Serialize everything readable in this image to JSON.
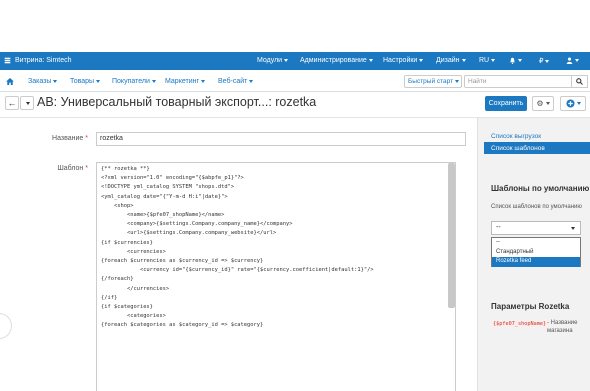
{
  "topbar": {
    "store": "Витрина: Simtech",
    "modules": "Модули",
    "admin": "Администрирование",
    "settings": "Настройки",
    "design": "Дизайн",
    "lang": "RU",
    "currency": "₽"
  },
  "menu": {
    "orders": "Заказы",
    "products": "Товары",
    "customers": "Покупатели",
    "marketing": "Маркетинг",
    "website": "Веб-сайт",
    "quick_start": "Быстрый старт",
    "search_placeholder": "Найти"
  },
  "page": {
    "title": "AB: Универсальный товарный экспорт...: rozetka",
    "save": "Сохранить"
  },
  "form": {
    "name_label": "Название",
    "name_value": "rozetka",
    "template_label": "Шаблон",
    "template_lines": [
      "{** rozetka **}",
      "<?xml version=\"1.0\" encoding=\"{$abpfe_p1}\"?>",
      "<!DOCTYPE yml_catalog SYSTEM \"shops.dtd\">",
      "<yml_catalog date=\"{\"Y-m-d H:i\"|date}\">",
      "    <shop>",
      "        <name>{$pfe07_shopName}</name>",
      "        <company>{$settings.Company.company_name}</company>",
      "        <url>{$settings.Company.company_website}</url>",
      "{if $currencies}",
      "        <currencies>",
      "{foreach $currencies as $currency_id => $currency}",
      "            <currency id=\"{$currency_id}\" rate=\"{$currency.coefficient|default:1}\"/>",
      "{/foreach}",
      "        </currencies>",
      "{/if}",
      "{if $categories}",
      "        <categories>",
      "{foreach $categories as $category_id => $category}"
    ]
  },
  "sidebar": {
    "links": [
      "Список выгрузок",
      "Список шаблонов"
    ],
    "default_title": "Шаблоны по умолчанию",
    "list_label": "Список шаблонов по умолчанию",
    "select_value": "--",
    "options": [
      "--",
      "Стандартный",
      "Rozetka feed"
    ],
    "params_title": "Параметры Rozetka",
    "param_code": "{$pfe07_shopName}",
    "param_desc": "- Название магазина"
  },
  "colors": {
    "primary": "#1b78c1",
    "sidebar_bg": "#f2f2f2"
  }
}
